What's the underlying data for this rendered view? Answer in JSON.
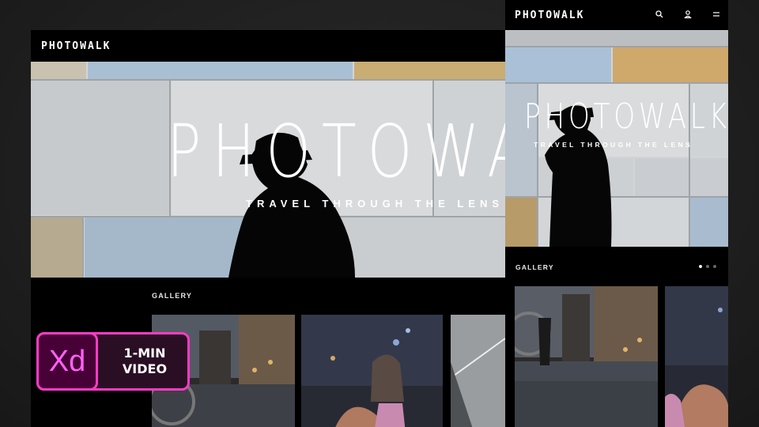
{
  "desktop": {
    "brand": "PHOTOWALK",
    "hero_title": "PHOTOWALK",
    "hero_subtitle": "TRAVEL THROUGH THE LENS",
    "gallery_label": "GALLERY"
  },
  "mobile": {
    "brand": "PHOTOWALK",
    "icons": [
      "search-icon",
      "user-icon",
      "menu-icon"
    ],
    "hero_title": "PHOTOWALK",
    "hero_subtitle": "TRAVEL THROUGH THE LENS",
    "gallery_label": "GALLERY",
    "pager": {
      "count": 3,
      "active": 0
    }
  },
  "badge": {
    "app": "Xd",
    "line1": "1-MIN",
    "line2": "VIDEO"
  },
  "colors": {
    "accent": "#ff3bc4",
    "xd_purple": "#470137",
    "xd_text": "#ff61f6",
    "background": "#1f1f1f"
  }
}
